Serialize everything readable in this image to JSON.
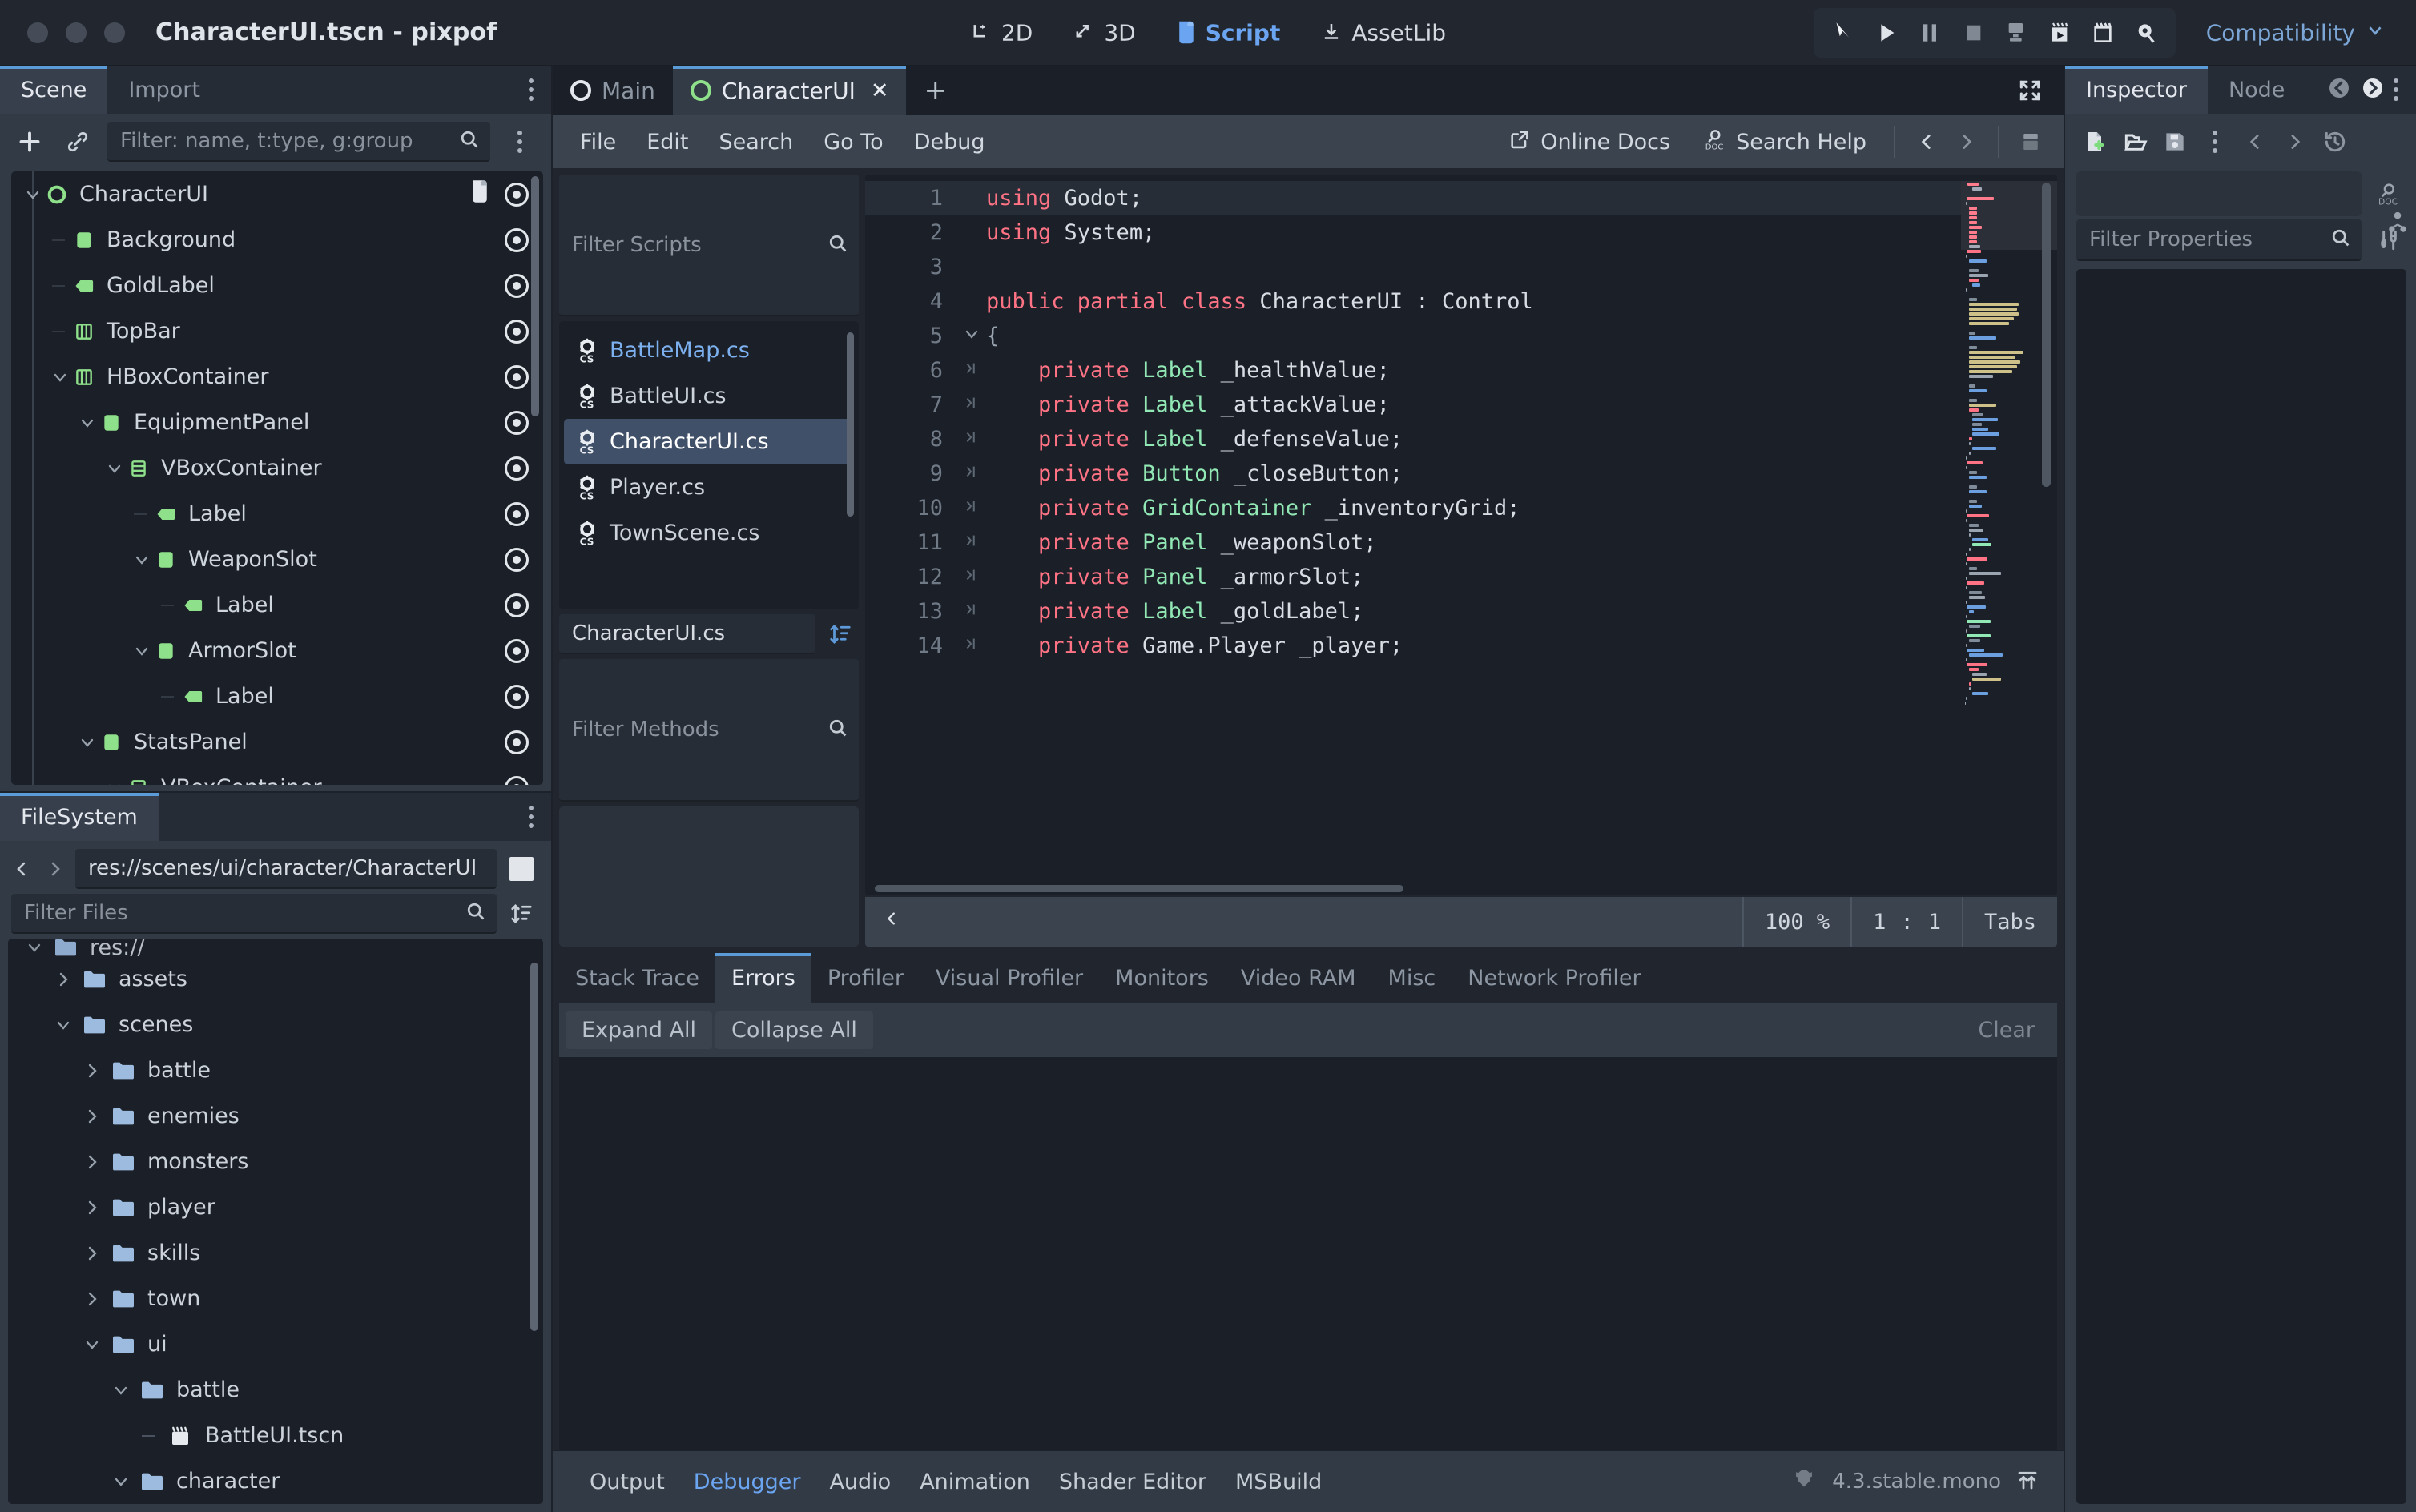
{
  "window": {
    "title": "CharacterUI.tscn - pixpof",
    "traffic_lights": [
      "close",
      "minimize",
      "maximize"
    ]
  },
  "main_modes": [
    {
      "label": "2D",
      "icon": "2d-icon",
      "active": false
    },
    {
      "label": "3D",
      "icon": "3d-icon",
      "active": false
    },
    {
      "label": "Script",
      "icon": "script-icon",
      "active": true
    },
    {
      "label": "AssetLib",
      "icon": "assetlib-icon",
      "active": false
    }
  ],
  "run_toolbar": {
    "icons": [
      "play-cursor-icon",
      "play-icon",
      "pause-icon",
      "stop-icon",
      "movie-writer-icon",
      "run-scene-icon",
      "run-custom-scene-icon",
      "remote-debug-icon"
    ],
    "renderer": "Compatibility",
    "renderer_chevron": "chevron-down-icon",
    "renderer_color": "#7ba6d6"
  },
  "scene_dock": {
    "tabs": [
      {
        "label": "Scene",
        "active": true
      },
      {
        "label": "Import",
        "active": false
      }
    ],
    "toolbar": {
      "add_icon": "plus-icon",
      "link_icon": "instance-child-scene-icon",
      "filter_placeholder": "Filter: name, t:type, g:group",
      "search_icon": "search-icon",
      "menu_icon": "vertical-dots-icon"
    },
    "tree": [
      {
        "name": "CharacterUI",
        "depth": 0,
        "icon": "control-node-icon",
        "expander": "chevron-down-icon",
        "script": true,
        "visibility": "visible-eye-icon"
      },
      {
        "name": "Background",
        "depth": 1,
        "icon": "panel-node-icon",
        "expander": "",
        "script": false,
        "visibility": "visible-eye-icon"
      },
      {
        "name": "GoldLabel",
        "depth": 1,
        "icon": "label-node-icon",
        "expander": "",
        "script": false,
        "visibility": "visible-eye-icon"
      },
      {
        "name": "TopBar",
        "depth": 1,
        "icon": "hbox-node-icon",
        "expander": "",
        "script": false,
        "visibility": "visible-eye-icon"
      },
      {
        "name": "HBoxContainer",
        "depth": 1,
        "icon": "hbox-node-icon",
        "expander": "chevron-down-icon",
        "script": false,
        "visibility": "visible-eye-icon"
      },
      {
        "name": "EquipmentPanel",
        "depth": 2,
        "icon": "panel-node-icon",
        "expander": "chevron-down-icon",
        "script": false,
        "visibility": "visible-eye-icon"
      },
      {
        "name": "VBoxContainer",
        "depth": 3,
        "icon": "vbox-node-icon",
        "expander": "chevron-down-icon",
        "script": false,
        "visibility": "visible-eye-icon"
      },
      {
        "name": "Label",
        "depth": 4,
        "icon": "label-node-icon",
        "expander": "",
        "script": false,
        "visibility": "visible-eye-icon"
      },
      {
        "name": "WeaponSlot",
        "depth": 4,
        "icon": "panel-node-icon",
        "expander": "chevron-down-icon",
        "script": false,
        "visibility": "visible-eye-icon"
      },
      {
        "name": "Label",
        "depth": 5,
        "icon": "label-node-icon",
        "expander": "",
        "script": false,
        "visibility": "visible-eye-icon"
      },
      {
        "name": "ArmorSlot",
        "depth": 4,
        "icon": "panel-node-icon",
        "expander": "chevron-down-icon",
        "script": false,
        "visibility": "visible-eye-icon"
      },
      {
        "name": "Label",
        "depth": 5,
        "icon": "label-node-icon",
        "expander": "",
        "script": false,
        "visibility": "visible-eye-icon"
      },
      {
        "name": "StatsPanel",
        "depth": 2,
        "icon": "panel-node-icon",
        "expander": "chevron-down-icon",
        "script": false,
        "visibility": "visible-eye-icon"
      },
      {
        "name": "VBoxContainer",
        "depth": 3,
        "icon": "vbox-node-icon",
        "expander": "chevron-down-icon",
        "script": false,
        "visibility": "visible-eye-icon"
      }
    ]
  },
  "filesystem_dock": {
    "tabs": [
      {
        "label": "FileSystem",
        "active": true
      }
    ],
    "menu_icon": "vertical-dots-icon",
    "path": "res://scenes/ui/character/CharacterUI",
    "back_icon": "chevron-left-icon",
    "forward_icon": "chevron-right-icon",
    "toggle_split_icon": "toggle-split-mode-icon",
    "filter_placeholder": "Filter Files",
    "search_icon": "search-icon",
    "sort_icon": "sort-icon",
    "tree": [
      {
        "name": "res://",
        "depth": 0,
        "expander": "chevron-down-icon",
        "kind": "folder",
        "clipped": true
      },
      {
        "name": "assets",
        "depth": 1,
        "expander": "chevron-right-icon",
        "kind": "folder"
      },
      {
        "name": "scenes",
        "depth": 1,
        "expander": "chevron-down-icon",
        "kind": "folder"
      },
      {
        "name": "battle",
        "depth": 2,
        "expander": "chevron-right-icon",
        "kind": "folder"
      },
      {
        "name": "enemies",
        "depth": 2,
        "expander": "chevron-right-icon",
        "kind": "folder"
      },
      {
        "name": "monsters",
        "depth": 2,
        "expander": "chevron-right-icon",
        "kind": "folder"
      },
      {
        "name": "player",
        "depth": 2,
        "expander": "chevron-right-icon",
        "kind": "folder"
      },
      {
        "name": "skills",
        "depth": 2,
        "expander": "chevron-right-icon",
        "kind": "folder"
      },
      {
        "name": "town",
        "depth": 2,
        "expander": "chevron-right-icon",
        "kind": "folder"
      },
      {
        "name": "ui",
        "depth": 2,
        "expander": "chevron-down-icon",
        "kind": "folder"
      },
      {
        "name": "battle",
        "depth": 3,
        "expander": "chevron-down-icon",
        "kind": "folder"
      },
      {
        "name": "BattleUI.tscn",
        "depth": 4,
        "expander": "",
        "kind": "scene"
      },
      {
        "name": "character",
        "depth": 3,
        "expander": "chevron-down-icon",
        "kind": "folder"
      }
    ]
  },
  "script_editor": {
    "tabs": [
      {
        "label": "Main",
        "active": false,
        "icon": "control-node-icon",
        "closable": false
      },
      {
        "label": "CharacterUI",
        "active": true,
        "icon": "control-node-icon-green",
        "closable": true,
        "close_icon": "close-icon"
      }
    ],
    "add_tab_icon": "plus-icon",
    "expand_icon": "expand-bottom-panel-icon",
    "menus": [
      "File",
      "Edit",
      "Search",
      "Go To",
      "Debug"
    ],
    "online_docs": {
      "label": "Online Docs",
      "icon": "external-link-icon"
    },
    "search_help": {
      "label": "Search Help",
      "icon": "help-search-icon"
    },
    "history_back_icon": "chevron-left-icon",
    "history_forward_icon": "chevron-right-icon",
    "panel_layout_icon": "script-panel-icon",
    "scripts_filter_placeholder": "Filter Scripts",
    "scripts_search_icon": "search-icon",
    "script_list": [
      {
        "name": "BattleMap.cs",
        "icon": "csharp-script-icon",
        "selected": false,
        "unsaved": true
      },
      {
        "name": "BattleUI.cs",
        "icon": "csharp-script-icon",
        "selected": false,
        "unsaved": false
      },
      {
        "name": "CharacterUI.cs",
        "icon": "csharp-script-icon",
        "selected": true,
        "unsaved": false
      },
      {
        "name": "Player.cs",
        "icon": "csharp-script-icon",
        "selected": false,
        "unsaved": false
      },
      {
        "name": "TownScene.cs",
        "icon": "csharp-script-icon",
        "selected": false,
        "unsaved": false
      }
    ],
    "current_script": "CharacterUI.cs",
    "sort_icon": "sort-icon",
    "methods_filter_placeholder": "Filter Methods",
    "methods_search_icon": "search-icon",
    "code": [
      {
        "num": "1",
        "fold": "",
        "current": true,
        "tokens": [
          {
            "t": "using",
            "c": "kw"
          },
          {
            "t": " Godot;",
            "c": "id"
          }
        ]
      },
      {
        "num": "2",
        "fold": "",
        "current": false,
        "tokens": [
          {
            "t": "using",
            "c": "kw"
          },
          {
            "t": " System;",
            "c": "id"
          }
        ]
      },
      {
        "num": "3",
        "fold": "",
        "current": false,
        "tokens": []
      },
      {
        "num": "4",
        "fold": "",
        "current": false,
        "tokens": [
          {
            "t": "public partial class",
            "c": "kw"
          },
          {
            "t": " CharacterUI : Control",
            "c": "id"
          }
        ]
      },
      {
        "num": "5",
        "fold": "chevron-down-icon",
        "current": false,
        "tokens": [
          {
            "t": "{",
            "c": "punc"
          }
        ]
      },
      {
        "num": "6",
        "fold": "indent-marker",
        "current": false,
        "tokens": [
          {
            "t": "    private",
            "c": "kw"
          },
          {
            "t": " Label",
            "c": "type"
          },
          {
            "t": " _healthValue;",
            "c": "id"
          }
        ]
      },
      {
        "num": "7",
        "fold": "indent-marker",
        "current": false,
        "tokens": [
          {
            "t": "    private",
            "c": "kw"
          },
          {
            "t": " Label",
            "c": "type"
          },
          {
            "t": " _attackValue;",
            "c": "id"
          }
        ]
      },
      {
        "num": "8",
        "fold": "indent-marker",
        "current": false,
        "tokens": [
          {
            "t": "    private",
            "c": "kw"
          },
          {
            "t": " Label",
            "c": "type"
          },
          {
            "t": " _defenseValue;",
            "c": "id"
          }
        ]
      },
      {
        "num": "9",
        "fold": "indent-marker",
        "current": false,
        "tokens": [
          {
            "t": "    private",
            "c": "kw"
          },
          {
            "t": " Button",
            "c": "type"
          },
          {
            "t": " _closeButton;",
            "c": "id"
          }
        ]
      },
      {
        "num": "10",
        "fold": "indent-marker",
        "current": false,
        "tokens": [
          {
            "t": "    private",
            "c": "kw"
          },
          {
            "t": " GridContainer",
            "c": "type"
          },
          {
            "t": " _inventoryGrid;",
            "c": "id"
          }
        ]
      },
      {
        "num": "11",
        "fold": "indent-marker",
        "current": false,
        "tokens": [
          {
            "t": "    private",
            "c": "kw"
          },
          {
            "t": " Panel",
            "c": "type"
          },
          {
            "t": " _weaponSlot;",
            "c": "id"
          }
        ]
      },
      {
        "num": "12",
        "fold": "indent-marker",
        "current": false,
        "tokens": [
          {
            "t": "    private",
            "c": "kw"
          },
          {
            "t": " Panel",
            "c": "type"
          },
          {
            "t": " _armorSlot;",
            "c": "id"
          }
        ]
      },
      {
        "num": "13",
        "fold": "indent-marker",
        "current": false,
        "tokens": [
          {
            "t": "    private",
            "c": "kw"
          },
          {
            "t": " Label",
            "c": "type"
          },
          {
            "t": " _goldLabel;",
            "c": "id"
          }
        ]
      },
      {
        "num": "14",
        "fold": "indent-marker",
        "current": false,
        "tokens": [
          {
            "t": "    private",
            "c": "kw"
          },
          {
            "t": " Game.Player",
            "c": "id"
          },
          {
            "t": " _player;",
            "c": "id"
          }
        ]
      }
    ],
    "status": {
      "back_icon": "chevron-left-icon",
      "zoom": "100 %",
      "line": "1",
      "col": "1",
      "indent": "Tabs"
    }
  },
  "debugger": {
    "tabs": [
      {
        "label": "Stack Trace",
        "active": false
      },
      {
        "label": "Errors",
        "active": true
      },
      {
        "label": "Profiler",
        "active": false
      },
      {
        "label": "Visual Profiler",
        "active": false
      },
      {
        "label": "Monitors",
        "active": false
      },
      {
        "label": "Video RAM",
        "active": false
      },
      {
        "label": "Misc",
        "active": false
      },
      {
        "label": "Network Profiler",
        "active": false
      }
    ],
    "expand_all": "Expand All",
    "collapse_all": "Collapse All",
    "clear": "Clear"
  },
  "bottom_bar": {
    "items": [
      {
        "label": "Output",
        "active": false
      },
      {
        "label": "Debugger",
        "active": true
      },
      {
        "label": "Audio",
        "active": false
      },
      {
        "label": "Animation",
        "active": false
      },
      {
        "label": "Shader Editor",
        "active": false
      },
      {
        "label": "MSBuild",
        "active": false
      }
    ],
    "version": "4.3.stable.mono",
    "godot_icon": "godot-logo-icon",
    "layout_icon": "expand-bottom-panel-icon"
  },
  "inspector_dock": {
    "tabs": [
      {
        "label": "Inspector",
        "active": true
      },
      {
        "label": "Node",
        "active": false
      }
    ],
    "history_back_icon": "circle-chevron-left-icon",
    "history_forward_icon": "circle-chevron-right-icon",
    "menu_icon": "vertical-dots-icon",
    "toolbar_icons": [
      "new-resource-icon",
      "open-resource-icon",
      "save-resource-icon",
      "resource-menu-icon",
      "object-prev-icon",
      "object-next-icon",
      "history-icon"
    ],
    "doc_icon": "help-search-icon",
    "filter_placeholder": "Filter Properties",
    "search_icon": "search-icon",
    "tools_icon": "editor-settings-icon",
    "side_icons": [
      "skeleton-icon"
    ]
  },
  "colors": {
    "accent": "#5b9bd8",
    "panel_bg": "#323a45",
    "dark_bg": "#1b2028",
    "mid_bg": "#21262e",
    "selection": "#405068",
    "keyword": "#ff7385",
    "type": "#91e8b4",
    "node_green": "#8fe08b",
    "folder_blue": "#9cbbdf",
    "text": "#cfd5dd"
  }
}
